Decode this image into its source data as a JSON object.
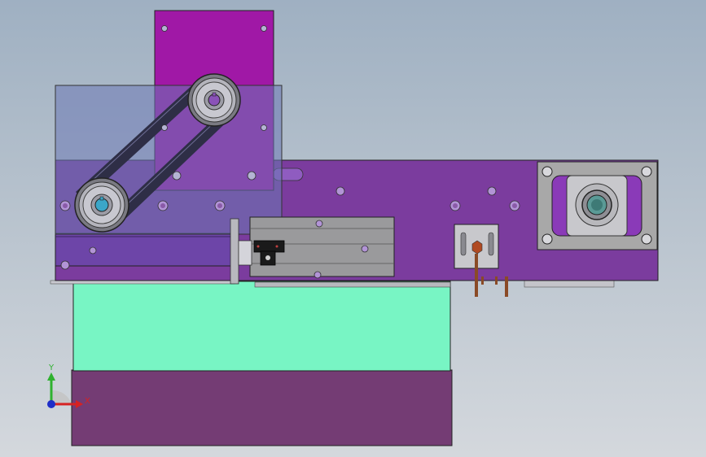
{
  "scene": {
    "background_top": "#9fb0c2",
    "background_bottom": "#d4d8dd",
    "colors": {
      "top_plate": "#a018a6",
      "glass_cover": "#6b78b5",
      "main_plate": "#7b3c9e",
      "lower_plate": "#6d45a8",
      "hopper": "#78f5c4",
      "base_box": "#743c74",
      "cylinder_body": "#9a9a9c",
      "motor_mount": "#a8a8a8",
      "belt": "#2e2e46",
      "rod": "#8a4a26"
    }
  },
  "triad": {
    "y_label": "Y",
    "x_label": "X",
    "y_color": "#2fb12f",
    "x_color": "#d62222",
    "z_color": "#1e2ec8"
  }
}
